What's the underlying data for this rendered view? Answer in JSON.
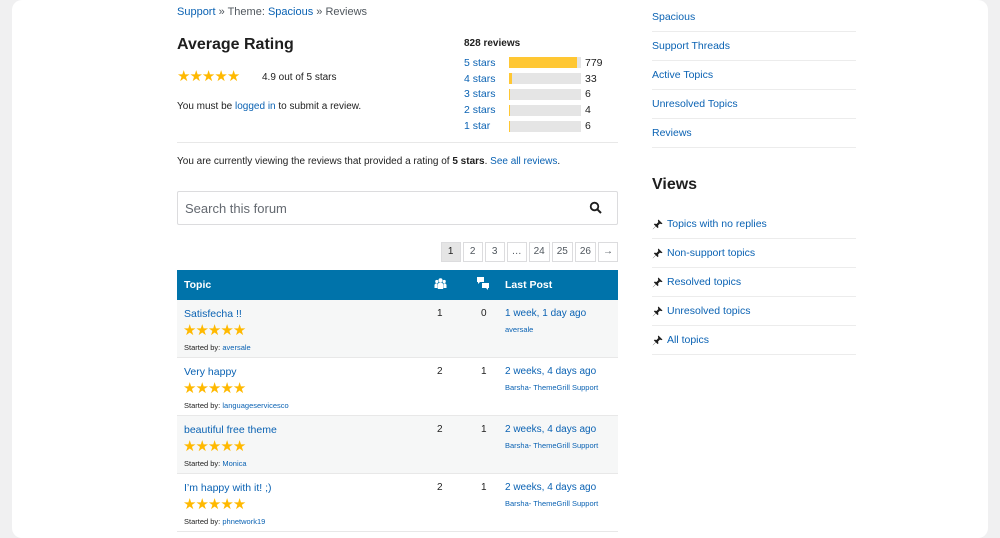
{
  "breadcrumb": {
    "support": "Support",
    "sep1": "»",
    "theme_prefix": "Theme:",
    "theme_name": "Spacious",
    "sep2": "»",
    "current": "Reviews"
  },
  "rating": {
    "title": "Average Rating",
    "average_text": "4.9 out of 5 stars",
    "average_value": 4.9,
    "login_prefix": "You must be",
    "login_link": "logged in",
    "login_suffix": "to submit a review.",
    "total_reviews": "828 reviews",
    "breakdown": [
      {
        "label": "5 stars",
        "count": "779",
        "fraction": 0.94
      },
      {
        "label": "4 stars",
        "count": "33",
        "fraction": 0.04
      },
      {
        "label": "3 stars",
        "count": "6",
        "fraction": 0.01
      },
      {
        "label": "2 stars",
        "count": "4",
        "fraction": 0.005
      },
      {
        "label": "1 star",
        "count": "6",
        "fraction": 0.01
      }
    ]
  },
  "filter_note": {
    "prefix": "You are currently viewing the reviews that provided a rating of",
    "rating": "5 stars",
    "suffix": ".",
    "see_all": "See all reviews",
    "end": "."
  },
  "search": {
    "placeholder": "Search this forum",
    "icon": "search-icon"
  },
  "pagination": [
    "1",
    "2",
    "3",
    "…",
    "24",
    "25",
    "26",
    "→"
  ],
  "table": {
    "header": {
      "topic": "Topic",
      "voices_icon": "people-icon",
      "replies_icon": "speech-bubbles-icon",
      "last_post": "Last Post"
    },
    "rows": [
      {
        "title": "Satisfecha !!",
        "stars": 5,
        "started_label": "Started by:",
        "author": "aversale",
        "voices": "1",
        "replies": "0",
        "freshness": "1 week, 1 day ago",
        "last_by": "aversale"
      },
      {
        "title": "Very happy",
        "stars": 5,
        "started_label": "Started by:",
        "author": "languageservicesco",
        "voices": "2",
        "replies": "1",
        "freshness": "2 weeks, 4 days ago",
        "last_by": "Barsha- ThemeGrill Support"
      },
      {
        "title": "beautiful free theme",
        "stars": 5,
        "started_label": "Started by:",
        "author": "Monica",
        "voices": "2",
        "replies": "1",
        "freshness": "2 weeks, 4 days ago",
        "last_by": "Barsha- ThemeGrill Support"
      },
      {
        "title": "I’m happy with it! ;)",
        "stars": 5,
        "started_label": "Started by:",
        "author": "phnetwork19",
        "voices": "2",
        "replies": "1",
        "freshness": "2 weeks, 4 days ago",
        "last_by": "Barsha- ThemeGrill Support"
      }
    ]
  },
  "sidebar": {
    "links": [
      "Spacious",
      "Support Threads",
      "Active Topics",
      "Unresolved Topics",
      "Reviews"
    ],
    "views_title": "Views",
    "views": [
      "Topics with no replies",
      "Non-support topics",
      "Resolved topics",
      "Unresolved topics",
      "All topics"
    ],
    "view_icon": "pin-icon"
  },
  "colors": {
    "link": "#0a62b3",
    "star": "#ffb900",
    "bar_fill": "#ffc733",
    "table_header": "#0073aa"
  }
}
